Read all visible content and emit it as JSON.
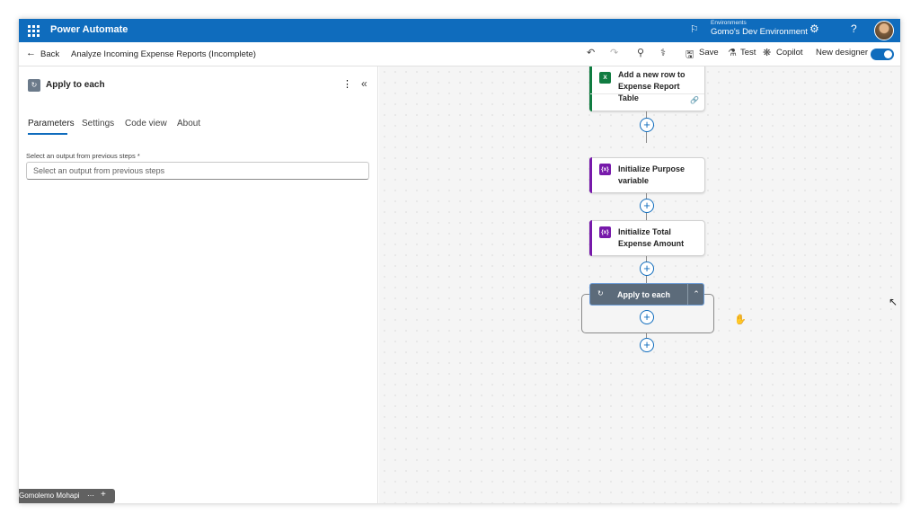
{
  "topbar": {
    "app_title": "Power Automate",
    "env_caption": "Environments",
    "env_name": "Gomo's Dev Environment",
    "icons": [
      "waffle-icon",
      "environment-icon",
      "settings-icon",
      "help-icon",
      "avatar"
    ]
  },
  "cmdbar": {
    "back_label": "Back",
    "flow_name": "Analyze Incoming Expense Reports (Incomplete)",
    "save_label": "Save",
    "test_label": "Test",
    "copilot_label": "Copilot",
    "new_designer_label": "New designer",
    "new_designer_on": true
  },
  "panel": {
    "title": "Apply to each",
    "tabs": [
      {
        "label": "Parameters",
        "active": true
      },
      {
        "label": "Settings",
        "active": false
      },
      {
        "label": "Code view",
        "active": false
      },
      {
        "label": "About",
        "active": false
      }
    ],
    "field_label": "Select an output from previous steps *",
    "field_placeholder": "Select an output from previous steps",
    "user_name": "Gomolemo Mohapi"
  },
  "canvas": {
    "cards": [
      {
        "label": "Add a new row to Expense Report Table",
        "icon": "excel-icon",
        "color": "#107c41"
      },
      {
        "label": "Initialize Purpose variable",
        "icon": "variable-icon",
        "color": "#7719aa"
      },
      {
        "label": "Initialize Total Expense Amount",
        "icon": "variable-icon",
        "color": "#7719aa"
      }
    ],
    "apply_label": "Apply to each"
  }
}
